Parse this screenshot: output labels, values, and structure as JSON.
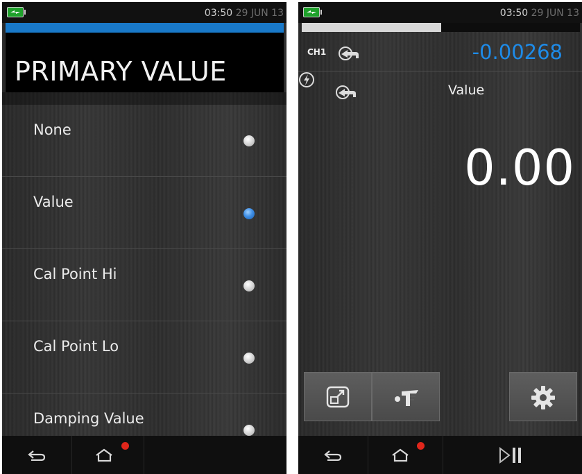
{
  "colors": {
    "accent_blue": "#1979c9",
    "reading_blue": "#1e8be8",
    "battery_green": "#1ea12b",
    "notify_red": "#e0261b"
  },
  "left": {
    "status": {
      "time": "03:50",
      "date": "29 JUN 13"
    },
    "title": "PRIMARY VALUE",
    "options": [
      {
        "label": "None",
        "selected": false
      },
      {
        "label": "Value",
        "selected": true
      },
      {
        "label": "Cal Point Hi",
        "selected": false
      },
      {
        "label": "Cal Point Lo",
        "selected": false
      },
      {
        "label": "Damping Value",
        "selected": false
      }
    ],
    "nav": {
      "icons": [
        "back-icon",
        "home-icon"
      ],
      "home_has_notification": true
    }
  },
  "right": {
    "status": {
      "time": "03:50",
      "date": "29 JUN 13"
    },
    "progress": 0.5,
    "channel": {
      "label": "CH1",
      "reading": "-0.00268",
      "icon": "return-arrow-icon"
    },
    "function": {
      "label": "Value",
      "icons": [
        "lightning-icon",
        "return-arrow-icon"
      ]
    },
    "main_value": "0.00",
    "softkeys": [
      "expand-window-icon",
      "filter-icon",
      "gear-icon"
    ],
    "nav": {
      "icons": [
        "back-icon",
        "home-icon",
        "play-pause-icon"
      ],
      "home_has_notification": true
    }
  }
}
